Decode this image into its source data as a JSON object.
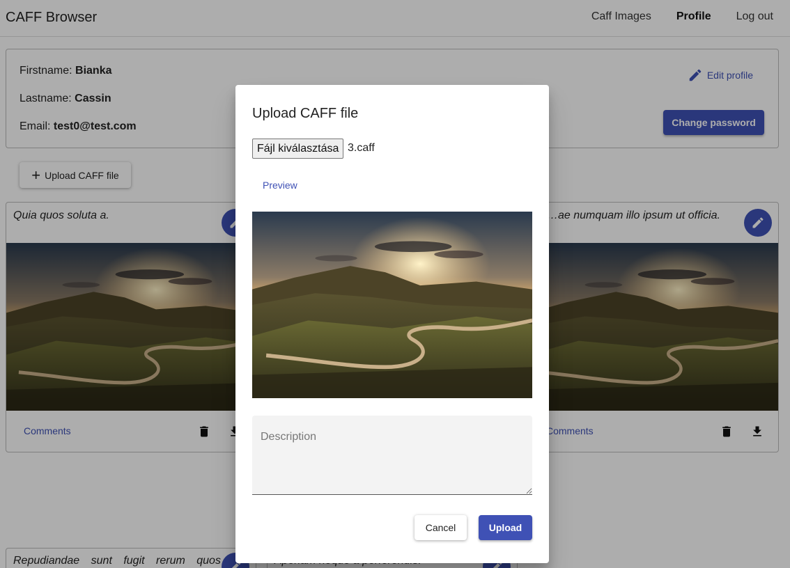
{
  "app": {
    "title": "CAFF Browser"
  },
  "nav": {
    "items": [
      {
        "label": "Caff Images"
      },
      {
        "label": "Profile"
      },
      {
        "label": "Log out"
      }
    ]
  },
  "profile": {
    "firstname_label": "Firstname:",
    "firstname": "Bianka",
    "lastname_label": "Lastname:",
    "lastname": "Cassin",
    "email_label": "Email:",
    "email": "test0@test.com",
    "edit_label": "Edit profile",
    "change_password_label": "Change password"
  },
  "upload_button_label": "Upload CAFF file",
  "cards": [
    {
      "description": "Quia quos soluta a.",
      "comments_label": "Comments"
    },
    {
      "description": "…ae numquam illo ipsum ut officia.",
      "comments_label": "Comments"
    },
    {
      "description": "Repudiandae sunt fugit rerum quos",
      "comments_label": ""
    },
    {
      "description": "Aperiam neque a perferendis.",
      "comments_label": ""
    }
  ],
  "dialog": {
    "title": "Upload CAFF file",
    "file_button_label": "Fájl kiválasztása",
    "file_name": "3.caff",
    "preview_label": "Preview",
    "description_placeholder": "Description",
    "cancel_label": "Cancel",
    "upload_label": "Upload"
  },
  "colors": {
    "primary": "#3f51b5",
    "overlay": "rgba(0,0,0,0.32)"
  },
  "icons": [
    "pencil-icon",
    "plus-icon",
    "trash-icon",
    "download-icon"
  ]
}
